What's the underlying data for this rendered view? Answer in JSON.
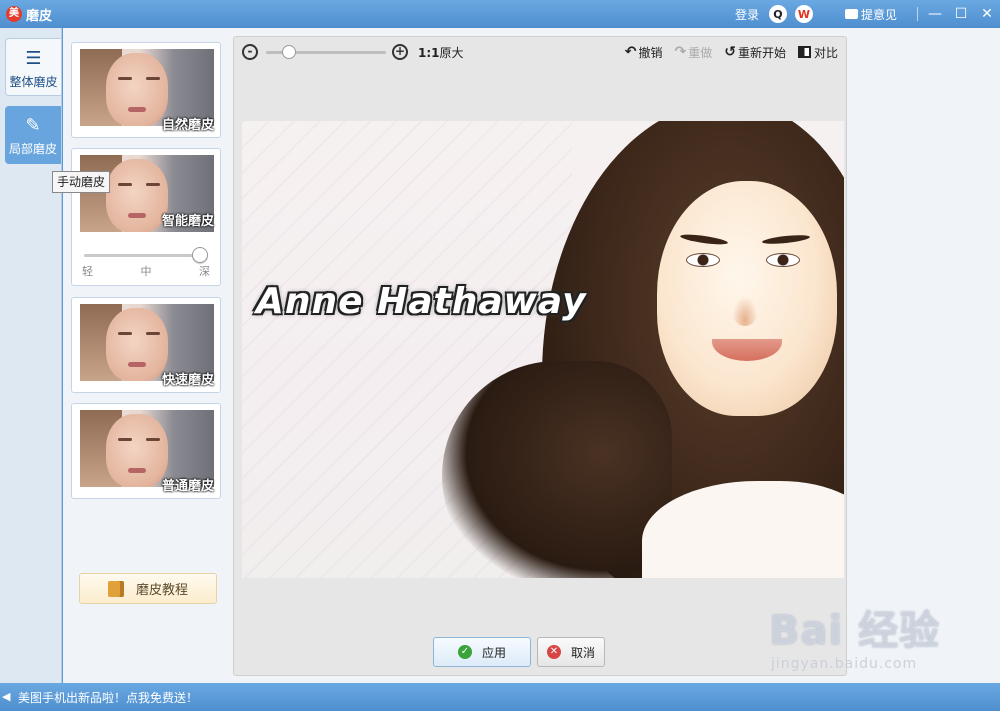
{
  "window": {
    "title": "磨皮",
    "logo_text": "美",
    "login_label": "登录",
    "feedback_label": "提意见"
  },
  "tabs": [
    {
      "label": "整体磨皮"
    },
    {
      "label": "局部磨皮"
    }
  ],
  "tooltip": "手动磨皮",
  "options": [
    {
      "label": "自然磨皮"
    },
    {
      "label": "智能磨皮",
      "strength_labels": [
        "轻",
        "中",
        "深"
      ],
      "strength_value": 1.0
    },
    {
      "label": "快速磨皮"
    },
    {
      "label": "普通磨皮"
    }
  ],
  "tutorial_label": "磨皮教程",
  "toolbar": {
    "ratio_bold": "1:1",
    "ratio_text": "原大",
    "undo": "撤销",
    "redo": "重做",
    "restart": "重新开始",
    "compare": "对比"
  },
  "photo": {
    "caption": "Anne Hathaway"
  },
  "actions": {
    "apply": "应用",
    "cancel": "取消"
  },
  "watermark": {
    "logo": "Bai 经验",
    "url": "jingyan.baidu.com"
  },
  "status": {
    "message": "美图手机出新品啦！点我免费送！"
  }
}
